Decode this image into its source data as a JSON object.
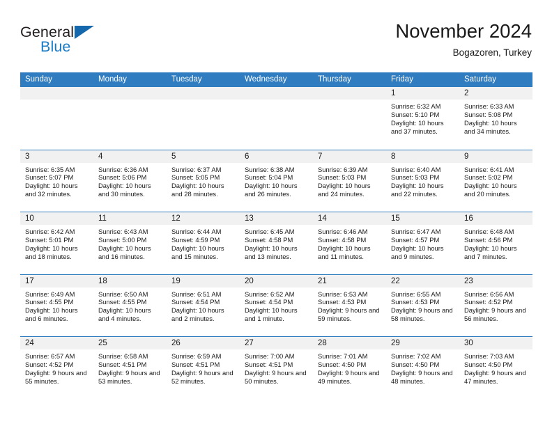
{
  "brand": {
    "name_part1": "General",
    "name_part2": "Blue",
    "triangle_color": "#1668ad",
    "blue_text_color": "#1a7bc4"
  },
  "header": {
    "title": "November 2024",
    "subtitle": "Bogazoren, Turkey"
  },
  "theme": {
    "header_blue": "#2f7cc0",
    "date_strip_gray": "#f1f1f1",
    "text_color": "#1a1a1a"
  },
  "weekday_headers": [
    "Sunday",
    "Monday",
    "Tuesday",
    "Wednesday",
    "Thursday",
    "Friday",
    "Saturday"
  ],
  "weeks": [
    [
      {
        "date": "",
        "sunrise": "",
        "sunset": "",
        "daylight": "",
        "empty": true
      },
      {
        "date": "",
        "sunrise": "",
        "sunset": "",
        "daylight": "",
        "empty": true
      },
      {
        "date": "",
        "sunrise": "",
        "sunset": "",
        "daylight": "",
        "empty": true
      },
      {
        "date": "",
        "sunrise": "",
        "sunset": "",
        "daylight": "",
        "empty": true
      },
      {
        "date": "",
        "sunrise": "",
        "sunset": "",
        "daylight": "",
        "empty": true
      },
      {
        "date": "1",
        "sunrise": "Sunrise: 6:32 AM",
        "sunset": "Sunset: 5:10 PM",
        "daylight": "Daylight: 10 hours and 37 minutes.",
        "empty": false
      },
      {
        "date": "2",
        "sunrise": "Sunrise: 6:33 AM",
        "sunset": "Sunset: 5:08 PM",
        "daylight": "Daylight: 10 hours and 34 minutes.",
        "empty": false
      }
    ],
    [
      {
        "date": "3",
        "sunrise": "Sunrise: 6:35 AM",
        "sunset": "Sunset: 5:07 PM",
        "daylight": "Daylight: 10 hours and 32 minutes.",
        "empty": false
      },
      {
        "date": "4",
        "sunrise": "Sunrise: 6:36 AM",
        "sunset": "Sunset: 5:06 PM",
        "daylight": "Daylight: 10 hours and 30 minutes.",
        "empty": false
      },
      {
        "date": "5",
        "sunrise": "Sunrise: 6:37 AM",
        "sunset": "Sunset: 5:05 PM",
        "daylight": "Daylight: 10 hours and 28 minutes.",
        "empty": false
      },
      {
        "date": "6",
        "sunrise": "Sunrise: 6:38 AM",
        "sunset": "Sunset: 5:04 PM",
        "daylight": "Daylight: 10 hours and 26 minutes.",
        "empty": false
      },
      {
        "date": "7",
        "sunrise": "Sunrise: 6:39 AM",
        "sunset": "Sunset: 5:03 PM",
        "daylight": "Daylight: 10 hours and 24 minutes.",
        "empty": false
      },
      {
        "date": "8",
        "sunrise": "Sunrise: 6:40 AM",
        "sunset": "Sunset: 5:03 PM",
        "daylight": "Daylight: 10 hours and 22 minutes.",
        "empty": false
      },
      {
        "date": "9",
        "sunrise": "Sunrise: 6:41 AM",
        "sunset": "Sunset: 5:02 PM",
        "daylight": "Daylight: 10 hours and 20 minutes.",
        "empty": false
      }
    ],
    [
      {
        "date": "10",
        "sunrise": "Sunrise: 6:42 AM",
        "sunset": "Sunset: 5:01 PM",
        "daylight": "Daylight: 10 hours and 18 minutes.",
        "empty": false
      },
      {
        "date": "11",
        "sunrise": "Sunrise: 6:43 AM",
        "sunset": "Sunset: 5:00 PM",
        "daylight": "Daylight: 10 hours and 16 minutes.",
        "empty": false
      },
      {
        "date": "12",
        "sunrise": "Sunrise: 6:44 AM",
        "sunset": "Sunset: 4:59 PM",
        "daylight": "Daylight: 10 hours and 15 minutes.",
        "empty": false
      },
      {
        "date": "13",
        "sunrise": "Sunrise: 6:45 AM",
        "sunset": "Sunset: 4:58 PM",
        "daylight": "Daylight: 10 hours and 13 minutes.",
        "empty": false
      },
      {
        "date": "14",
        "sunrise": "Sunrise: 6:46 AM",
        "sunset": "Sunset: 4:58 PM",
        "daylight": "Daylight: 10 hours and 11 minutes.",
        "empty": false
      },
      {
        "date": "15",
        "sunrise": "Sunrise: 6:47 AM",
        "sunset": "Sunset: 4:57 PM",
        "daylight": "Daylight: 10 hours and 9 minutes.",
        "empty": false
      },
      {
        "date": "16",
        "sunrise": "Sunrise: 6:48 AM",
        "sunset": "Sunset: 4:56 PM",
        "daylight": "Daylight: 10 hours and 7 minutes.",
        "empty": false
      }
    ],
    [
      {
        "date": "17",
        "sunrise": "Sunrise: 6:49 AM",
        "sunset": "Sunset: 4:55 PM",
        "daylight": "Daylight: 10 hours and 6 minutes.",
        "empty": false
      },
      {
        "date": "18",
        "sunrise": "Sunrise: 6:50 AM",
        "sunset": "Sunset: 4:55 PM",
        "daylight": "Daylight: 10 hours and 4 minutes.",
        "empty": false
      },
      {
        "date": "19",
        "sunrise": "Sunrise: 6:51 AM",
        "sunset": "Sunset: 4:54 PM",
        "daylight": "Daylight: 10 hours and 2 minutes.",
        "empty": false
      },
      {
        "date": "20",
        "sunrise": "Sunrise: 6:52 AM",
        "sunset": "Sunset: 4:54 PM",
        "daylight": "Daylight: 10 hours and 1 minute.",
        "empty": false
      },
      {
        "date": "21",
        "sunrise": "Sunrise: 6:53 AM",
        "sunset": "Sunset: 4:53 PM",
        "daylight": "Daylight: 9 hours and 59 minutes.",
        "empty": false
      },
      {
        "date": "22",
        "sunrise": "Sunrise: 6:55 AM",
        "sunset": "Sunset: 4:53 PM",
        "daylight": "Daylight: 9 hours and 58 minutes.",
        "empty": false
      },
      {
        "date": "23",
        "sunrise": "Sunrise: 6:56 AM",
        "sunset": "Sunset: 4:52 PM",
        "daylight": "Daylight: 9 hours and 56 minutes.",
        "empty": false
      }
    ],
    [
      {
        "date": "24",
        "sunrise": "Sunrise: 6:57 AM",
        "sunset": "Sunset: 4:52 PM",
        "daylight": "Daylight: 9 hours and 55 minutes.",
        "empty": false
      },
      {
        "date": "25",
        "sunrise": "Sunrise: 6:58 AM",
        "sunset": "Sunset: 4:51 PM",
        "daylight": "Daylight: 9 hours and 53 minutes.",
        "empty": false
      },
      {
        "date": "26",
        "sunrise": "Sunrise: 6:59 AM",
        "sunset": "Sunset: 4:51 PM",
        "daylight": "Daylight: 9 hours and 52 minutes.",
        "empty": false
      },
      {
        "date": "27",
        "sunrise": "Sunrise: 7:00 AM",
        "sunset": "Sunset: 4:51 PM",
        "daylight": "Daylight: 9 hours and 50 minutes.",
        "empty": false
      },
      {
        "date": "28",
        "sunrise": "Sunrise: 7:01 AM",
        "sunset": "Sunset: 4:50 PM",
        "daylight": "Daylight: 9 hours and 49 minutes.",
        "empty": false
      },
      {
        "date": "29",
        "sunrise": "Sunrise: 7:02 AM",
        "sunset": "Sunset: 4:50 PM",
        "daylight": "Daylight: 9 hours and 48 minutes.",
        "empty": false
      },
      {
        "date": "30",
        "sunrise": "Sunrise: 7:03 AM",
        "sunset": "Sunset: 4:50 PM",
        "daylight": "Daylight: 9 hours and 47 minutes.",
        "empty": false
      }
    ]
  ]
}
